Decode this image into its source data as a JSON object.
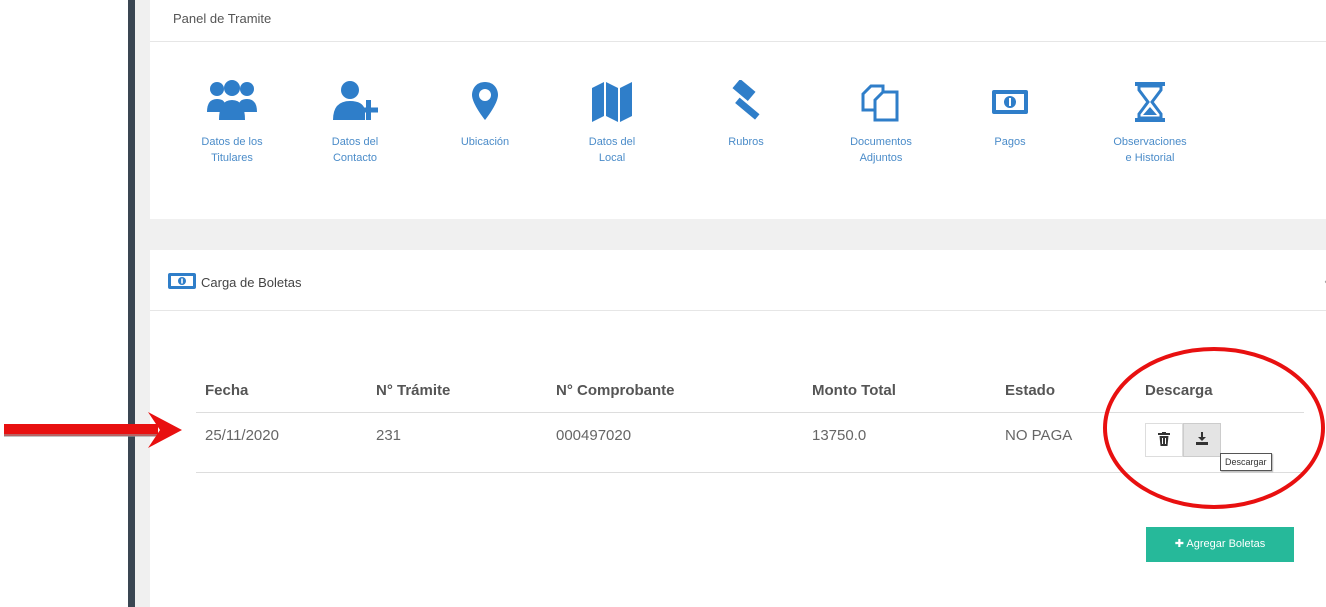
{
  "colors": {
    "sidebar": "#3a4652",
    "icon_blue": "#2f7ec9",
    "link_blue": "#4b8cc9",
    "success_green": "#26b99a",
    "annotation_red": "#e81010"
  },
  "panel_tramite": {
    "title": "Panel de Tramite",
    "items": [
      {
        "icon": "users-icon",
        "label": "Datos de los\nTitulares"
      },
      {
        "icon": "user-plus-icon",
        "label": "Datos del\nContacto"
      },
      {
        "icon": "map-marker-icon",
        "label": "Ubicación"
      },
      {
        "icon": "map-icon",
        "label": "Datos del\nLocal"
      },
      {
        "icon": "gavel-icon",
        "label": "Rubros"
      },
      {
        "icon": "files-icon",
        "label": "Documentos\nAdjuntos"
      },
      {
        "icon": "money-bill-icon",
        "label": "Pagos"
      },
      {
        "icon": "hourglass-icon",
        "label": "Observaciones\ne Historial"
      }
    ]
  },
  "carga_boletas": {
    "icon": "money-bill-icon",
    "title": "Carga de Boletas",
    "collapse_mark": "‹",
    "table": {
      "headers": [
        "Fecha",
        "N° Trámite",
        "N° Comprobante",
        "Monto Total",
        "Estado",
        "Descarga"
      ],
      "rows": [
        {
          "fecha": "25/11/2020",
          "tramite": "231",
          "comprobante": "000497020",
          "monto": "13750.0",
          "estado": "NO PAGA"
        }
      ]
    },
    "delete_icon": "trash-icon",
    "download_icon": "download-icon",
    "tooltip": "Descargar",
    "add_button": "✚ Agregar Boletas"
  }
}
